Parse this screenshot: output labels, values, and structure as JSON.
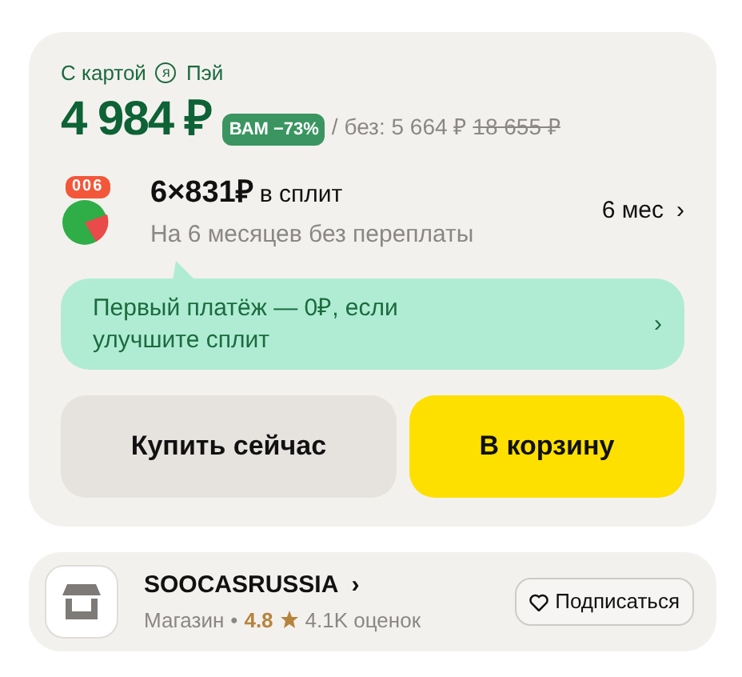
{
  "pay_card": {
    "card_label_prefix": "С картой",
    "card_label_suffix": "Пэй",
    "logo_letter": "я",
    "price": "4 984 ₽",
    "discount_badge": "ВАМ −73%",
    "without_label": "/ без: 5 664 ₽",
    "old_price": "18 655 ₽"
  },
  "split": {
    "badge": "006",
    "amount": "6×831₽",
    "amount_suffix": "в сплит",
    "subtitle": "На 6 месяцев без переплаты",
    "term": "6 мес",
    "term_chevron": "›"
  },
  "promo": {
    "text": "Первый платёж — 0₽, если улучшите сплит",
    "chevron": "›"
  },
  "buttons": [
    {
      "label": "Купить сейчас",
      "kind": "secondary"
    },
    {
      "label": "В корзину",
      "kind": "primary"
    }
  ],
  "shop": {
    "name": "SOOCASRUSSIA",
    "chevron": "›",
    "type": "Магазин",
    "separator": "•",
    "rating": "4.8",
    "reviews": "4.1K оценок",
    "subscribe": "Подписаться"
  }
}
